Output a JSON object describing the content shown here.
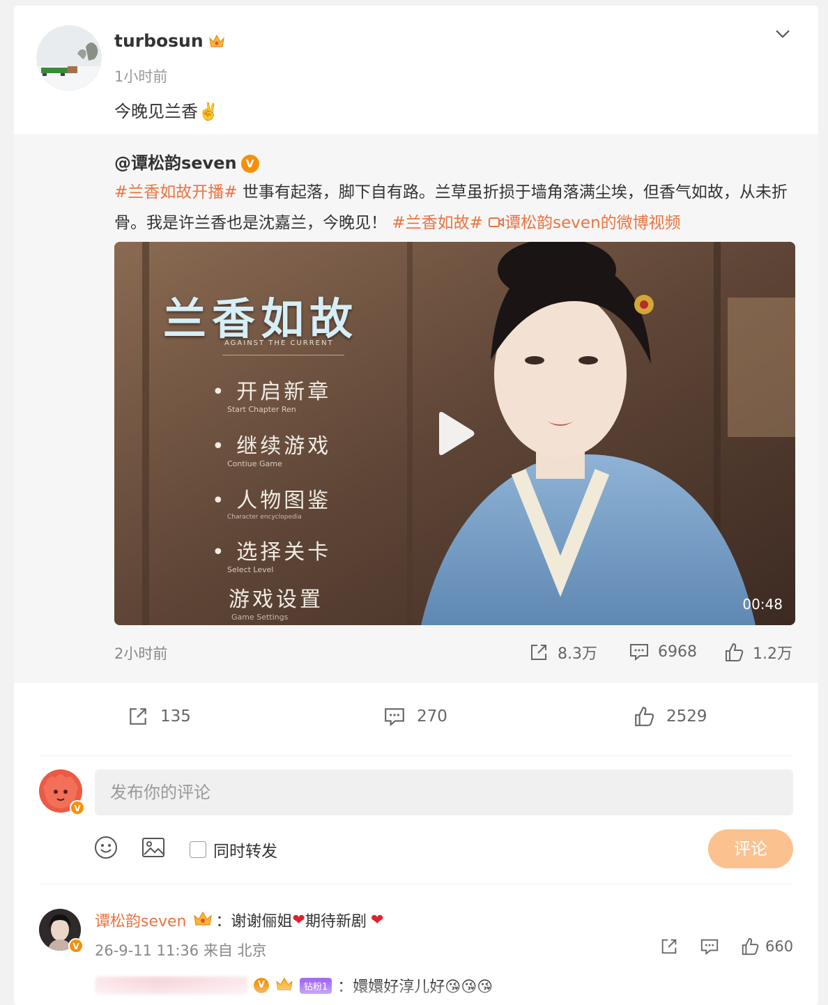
{
  "post": {
    "username": "turbosun",
    "time": "1小时前",
    "text": "今晚见兰香✌️"
  },
  "repost": {
    "author": "@谭松韵seven",
    "tag1": "#兰香如故开播#",
    "body1": " 世事有起落，脚下自有路。兰草虽折损于墙角落满尘埃，但香气如故，从未折骨。我是许兰香也是沈嘉兰，今晚见！ ",
    "tag2": "#兰香如故#",
    "video_link": "谭松韵seven的微博视频",
    "video": {
      "duration": "00:48",
      "title": "兰香如故",
      "subtitle": "AGAINST THE CURRENT",
      "menu": [
        {
          "cn": "开启新章",
          "en": "Start Chapter Ren"
        },
        {
          "cn": "继续游戏",
          "en": "Contiue Game"
        },
        {
          "cn": "人物图鉴",
          "en": "Character encyclopedia"
        },
        {
          "cn": "选择关卡",
          "en": "Select Level"
        },
        {
          "cn": "游戏设置",
          "en": "Game Settings"
        }
      ]
    },
    "time": "2小时前",
    "shares": "8.3万",
    "comments": "6968",
    "likes": "1.2万"
  },
  "actions": {
    "shares": "135",
    "comments": "270",
    "likes": "2529"
  },
  "composer": {
    "placeholder": "发布你的评论",
    "repost_label": "同时转发",
    "submit_label": "评论"
  },
  "comments": [
    {
      "name": "谭松韵seven",
      "text_a": "：谢谢俪姐",
      "text_b": "期待新剧",
      "meta": "26-9-11 11:36 来自 北京",
      "likes": "660"
    }
  ],
  "reply": {
    "badge": "钻粉1",
    "text": "：嬛嬛好淳儿好😘😘😘"
  },
  "colors": {
    "accent": "#eb7340",
    "verified": "#f5900c",
    "submit": "#fbc28f"
  }
}
